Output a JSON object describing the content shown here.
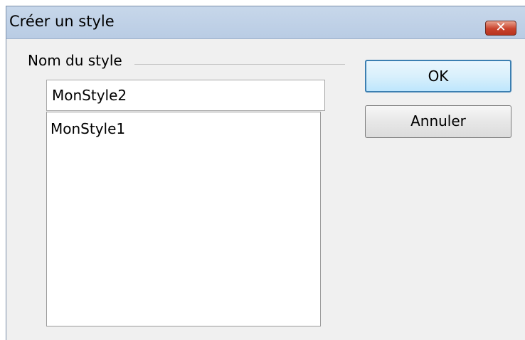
{
  "dialog": {
    "title": "Créer un style",
    "close_symbol": "✕"
  },
  "group": {
    "label": "Nom du style"
  },
  "name_input": {
    "value": "MonStyle2"
  },
  "style_list": {
    "items": [
      "MonStyle1"
    ]
  },
  "buttons": {
    "ok_label": "OK",
    "cancel_label": "Annuler"
  },
  "colors": {
    "titlebar": "#c7d7ea",
    "close_button": "#c9432d",
    "default_button_border": "#3c7fb1"
  }
}
